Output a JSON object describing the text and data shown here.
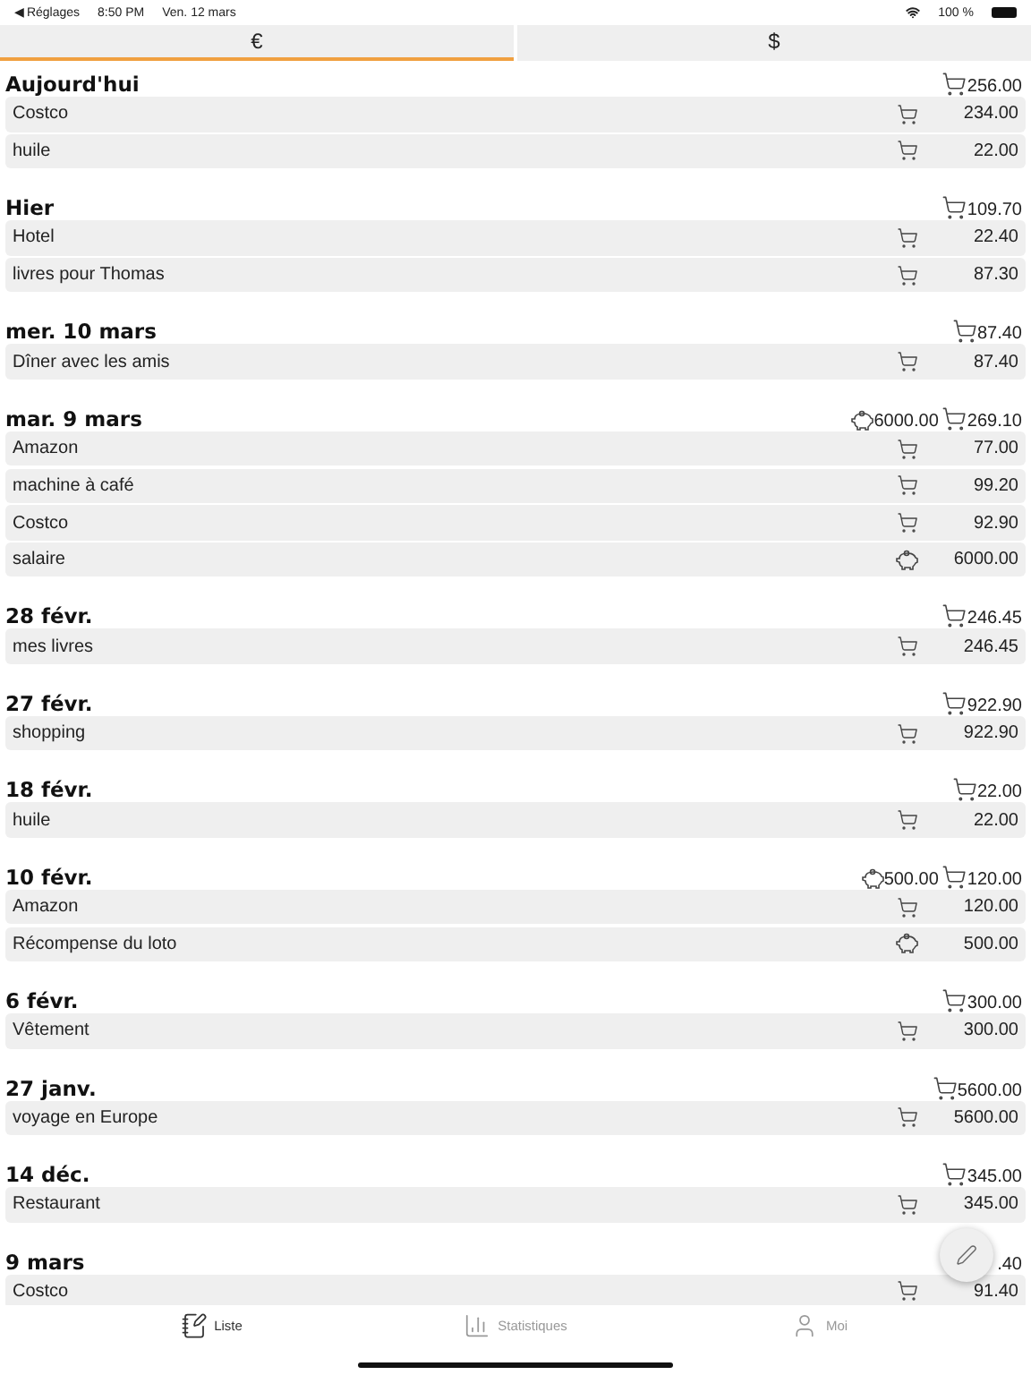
{
  "status_bar": {
    "back": "◀ Réglages",
    "time": "8:50 PM",
    "date": "Ven. 12 mars",
    "battery": "100 %"
  },
  "currency_tabs": [
    {
      "label": "€",
      "selected": true
    },
    {
      "label": "$",
      "selected": false
    }
  ],
  "groups": [
    {
      "date": "Aujourd'hui",
      "expense_total": "256.00",
      "rows": [
        {
          "name": "Costco",
          "kind": "expense",
          "amount": "234.00"
        },
        {
          "name": "huile",
          "kind": "expense",
          "amount": "22.00"
        }
      ]
    },
    {
      "date": "Hier",
      "expense_total": "109.70",
      "rows": [
        {
          "name": "Hotel",
          "kind": "expense",
          "amount": "22.40"
        },
        {
          "name": "livres pour Thomas",
          "kind": "expense",
          "amount": "87.30"
        }
      ]
    },
    {
      "date": "mer. 10 mars",
      "expense_total": "87.40",
      "rows": [
        {
          "name": "Dîner avec les amis",
          "kind": "expense",
          "amount": "87.40"
        }
      ]
    },
    {
      "date": "mar. 9 mars",
      "income_total": "6000.00",
      "expense_total": "269.10",
      "rows": [
        {
          "name": "Amazon",
          "kind": "expense",
          "amount": "77.00"
        },
        {
          "name": "machine à café",
          "kind": "expense",
          "amount": "99.20"
        },
        {
          "name": "Costco",
          "kind": "expense",
          "amount": "92.90"
        },
        {
          "name": "salaire",
          "kind": "income",
          "amount": "6000.00"
        }
      ]
    },
    {
      "date": "28 févr.",
      "expense_total": "246.45",
      "rows": [
        {
          "name": "mes livres",
          "kind": "expense",
          "amount": "246.45"
        }
      ]
    },
    {
      "date": "27 févr.",
      "expense_total": "922.90",
      "rows": [
        {
          "name": "shopping",
          "kind": "expense",
          "amount": "922.90"
        }
      ]
    },
    {
      "date": "18 févr.",
      "expense_total": "22.00",
      "rows": [
        {
          "name": "huile",
          "kind": "expense",
          "amount": "22.00"
        }
      ]
    },
    {
      "date": "10 févr.",
      "income_total": "500.00",
      "expense_total": "120.00",
      "rows": [
        {
          "name": "Amazon",
          "kind": "expense",
          "amount": "120.00"
        },
        {
          "name": "Récompense du loto",
          "kind": "income",
          "amount": "500.00"
        }
      ]
    },
    {
      "date": "6 févr.",
      "expense_total": "300.00",
      "rows": [
        {
          "name": "Vêtement",
          "kind": "expense",
          "amount": "300.00"
        }
      ]
    },
    {
      "date": "27 janv.",
      "expense_total": "5600.00",
      "rows": [
        {
          "name": "voyage en Europe",
          "kind": "expense",
          "amount": "5600.00"
        }
      ]
    },
    {
      "date": "14 déc.",
      "expense_total": "345.00",
      "rows": [
        {
          "name": "Restaurant",
          "kind": "expense",
          "amount": "345.00"
        }
      ]
    },
    {
      "date": "9 mars",
      "expense_total": ".40",
      "partial": true,
      "rows": [
        {
          "name": "Costco",
          "kind": "expense",
          "amount": "91.40"
        }
      ]
    }
  ],
  "bottom_tabs": [
    {
      "label": "Liste",
      "kind": "list",
      "selected": true
    },
    {
      "label": "Statistiques",
      "kind": "stats",
      "selected": false
    },
    {
      "label": "Moi",
      "kind": "profile",
      "selected": false
    }
  ]
}
